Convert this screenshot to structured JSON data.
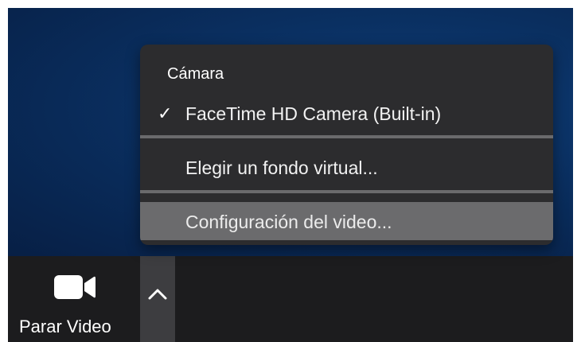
{
  "menu": {
    "header": "Cámara",
    "items": [
      {
        "label": "FaceTime HD Camera (Built-in)",
        "checked": true,
        "check_mark": "✓"
      },
      {
        "label": "Elegir un fondo virtual..."
      },
      {
        "label": "Configuración del video...",
        "highlighted": true
      }
    ]
  },
  "toolbar": {
    "video_button_label": "Parar Video",
    "video_icon": "video-camera-icon",
    "chevron_icon": "chevron-up-icon"
  },
  "colors": {
    "background_blue": "#0a2f60",
    "toolbar": "#1c1c1e",
    "menu": "#2c2c2e",
    "menu_highlight": "#6b6b6d"
  }
}
